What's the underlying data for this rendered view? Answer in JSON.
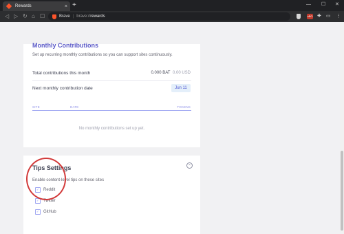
{
  "browser": {
    "tab_title": "Rewards",
    "tab_close": "×",
    "new_tab": "+",
    "window_controls": [
      "—",
      "☐",
      "✕"
    ],
    "nav": {
      "back": "◁",
      "forward": "▷",
      "reload": "↻",
      "home": "⌂",
      "bookmark": "☐"
    },
    "omnibox": {
      "brand": "Brave",
      "scheme": "brave://",
      "host": "rewards"
    },
    "extensions": {
      "ubo_label": "uBO",
      "puzzle": "✚",
      "cast": "▭",
      "menu": "⋮"
    }
  },
  "monthly": {
    "title": "Monthly Contributions",
    "description": "Set up recurring monthly contributions so you can support sites continuously.",
    "total_label": "Total contributions this month",
    "total_bat": "0.000 BAT",
    "total_usd": "0.00 USD",
    "next_label": "Next monthly contribution date",
    "next_date": "Jun 11",
    "columns": {
      "site": "SITE",
      "date": "DATE",
      "tokens": "TOKENS"
    },
    "empty_text": "No monthly contributions set up yet."
  },
  "tips": {
    "title": "Tips Settings",
    "close_icon": "×",
    "description": "Enable content-level tips on these sites",
    "sites": [
      {
        "label": "Reddit",
        "checked": true
      },
      {
        "label": "Twitter",
        "checked": true
      },
      {
        "label": "GitHub",
        "checked": true
      }
    ],
    "check_glyph": "✓"
  },
  "colors": {
    "accent": "#5a59c7",
    "annotation": "#d23a3a",
    "brave_orange": "#fb542b"
  }
}
